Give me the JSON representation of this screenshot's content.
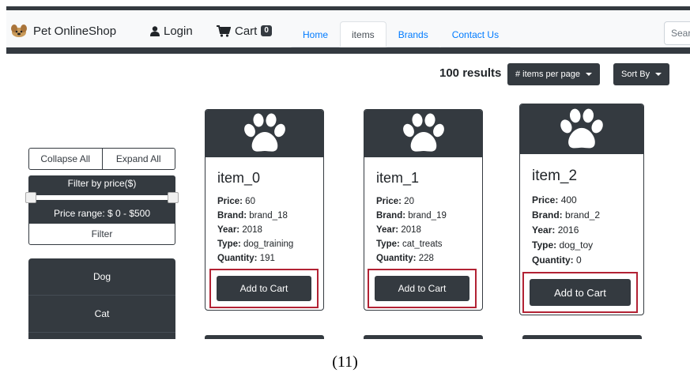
{
  "navbar": {
    "brand": "Pet OnlineShop",
    "login_label": "Login",
    "cart_label": "Cart",
    "cart_count": "0",
    "tabs": [
      {
        "label": "Home",
        "active": false
      },
      {
        "label": "items",
        "active": true
      },
      {
        "label": "Brands",
        "active": false
      },
      {
        "label": "Contact Us",
        "active": false
      }
    ],
    "search_placeholder": "Sear"
  },
  "results": {
    "count_text": "100  results",
    "items_per_page_label": "# items per page",
    "sort_label": "Sort By"
  },
  "sidebar": {
    "collapse_label": "Collapse All",
    "expand_label": "Expand All",
    "price_filter_title": "Filter by price($)",
    "price_range_text": "Price range: $  0   - $500",
    "filter_button": "Filter",
    "categories": [
      {
        "label": "Dog"
      },
      {
        "label": "Cat"
      }
    ]
  },
  "product_labels": {
    "price": "Price:",
    "brand": "Brand:",
    "year": "Year:",
    "type": "Type:",
    "quantity": "Quantity:",
    "add_to_cart": "Add to Cart"
  },
  "products": [
    {
      "name": "item_0",
      "price": "60",
      "brand": "brand_18",
      "year": "2018",
      "type": "dog_training",
      "quantity": "191"
    },
    {
      "name": "item_1",
      "price": "20",
      "brand": "brand_19",
      "year": "2018",
      "type": "cat_treats",
      "quantity": "228"
    },
    {
      "name": "item_2",
      "price": "400",
      "brand": "brand_2",
      "year": "2016",
      "type": "dog_toy",
      "quantity": "0"
    }
  ],
  "caption": "(11)",
  "icons": {
    "logo": "dog-logo-icon",
    "login": "user-icon",
    "cart": "cart-icon",
    "product": "paw-icon"
  },
  "colors": {
    "dark": "#343a40",
    "link": "#007bff",
    "highlight": "#b22234"
  }
}
